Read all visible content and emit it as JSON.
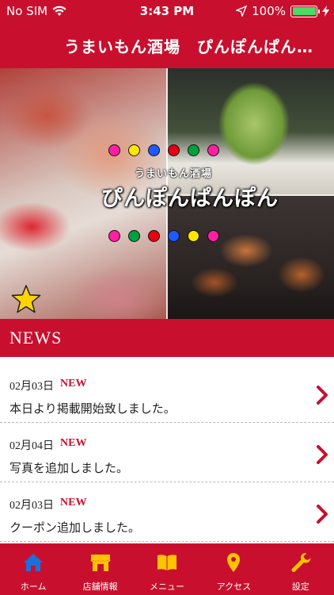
{
  "status_bar": {
    "carrier": "No SIM",
    "time": "3:43 PM",
    "battery": "100%"
  },
  "header": {
    "title": "うまいもん酒場　ぴんぽんぱん…"
  },
  "hero": {
    "logo_small": "うまいもん酒場",
    "logo_main": "ぴんぽんぱんぽん",
    "dots_top": [
      "#ff1fa3",
      "#ffe600",
      "#1e5bff",
      "#e60012",
      "#00a040",
      "#ff1fa3"
    ],
    "dots_bottom": [
      "#ff1fa3",
      "#00a040",
      "#e60012",
      "#1e5bff",
      "#ffe600",
      "#ff1fa3"
    ]
  },
  "news": {
    "title": "NEWS",
    "items": [
      {
        "date": "02月03日",
        "badge": "NEW",
        "text": "本日より掲載開始致しました。"
      },
      {
        "date": "02月04日",
        "badge": "NEW",
        "text": "写真を追加しました。"
      },
      {
        "date": "02月03日",
        "badge": "NEW",
        "text": "クーポン追加しました。"
      }
    ]
  },
  "tabs": [
    {
      "label": "ホーム",
      "icon": "home-icon",
      "color": "#1e6fd9"
    },
    {
      "label": "店舗情報",
      "icon": "shop-icon",
      "color": "#ffc400"
    },
    {
      "label": "メニュー",
      "icon": "book-icon",
      "color": "#ffc400"
    },
    {
      "label": "アクセス",
      "icon": "map-pin-icon",
      "color": "#ffc400"
    },
    {
      "label": "設定",
      "icon": "wrench-icon",
      "color": "#ffc400"
    }
  ],
  "colors": {
    "brand": "#c8102e",
    "accent": "#ffc400",
    "active": "#1e6fd9"
  }
}
